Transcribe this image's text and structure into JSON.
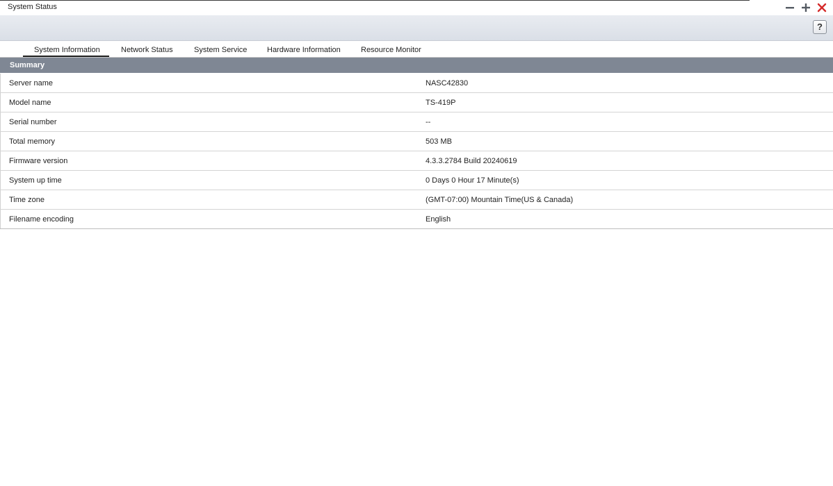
{
  "window": {
    "title": "System Status",
    "controls": {
      "minimize_icon": "minus-icon",
      "maximize_icon": "plus-icon",
      "close_icon": "close-icon",
      "close_color": "#d42a2a"
    }
  },
  "toolbar": {
    "help_label": "?"
  },
  "tabs": [
    {
      "label": "System Information",
      "active": true
    },
    {
      "label": "Network Status",
      "active": false
    },
    {
      "label": "System Service",
      "active": false
    },
    {
      "label": "Hardware Information",
      "active": false
    },
    {
      "label": "Resource Monitor",
      "active": false
    }
  ],
  "summary": {
    "header": "Summary",
    "rows": [
      {
        "label": "Server name",
        "value": "NASC42830"
      },
      {
        "label": "Model name",
        "value": "TS-419P"
      },
      {
        "label": "Serial number",
        "value": "--"
      },
      {
        "label": "Total memory",
        "value": "503 MB"
      },
      {
        "label": "Firmware version",
        "value": "4.3.3.2784 Build 20240619"
      },
      {
        "label": "System up time",
        "value": "0 Days 0 Hour 17 Minute(s)"
      },
      {
        "label": "Time zone",
        "value": "(GMT-07:00) Mountain Time(US & Canada)"
      },
      {
        "label": "Filename encoding",
        "value": "English"
      }
    ]
  },
  "colors": {
    "summary_header_bg": "#7f8794",
    "toolbar_bg": "#dfe3ea"
  }
}
